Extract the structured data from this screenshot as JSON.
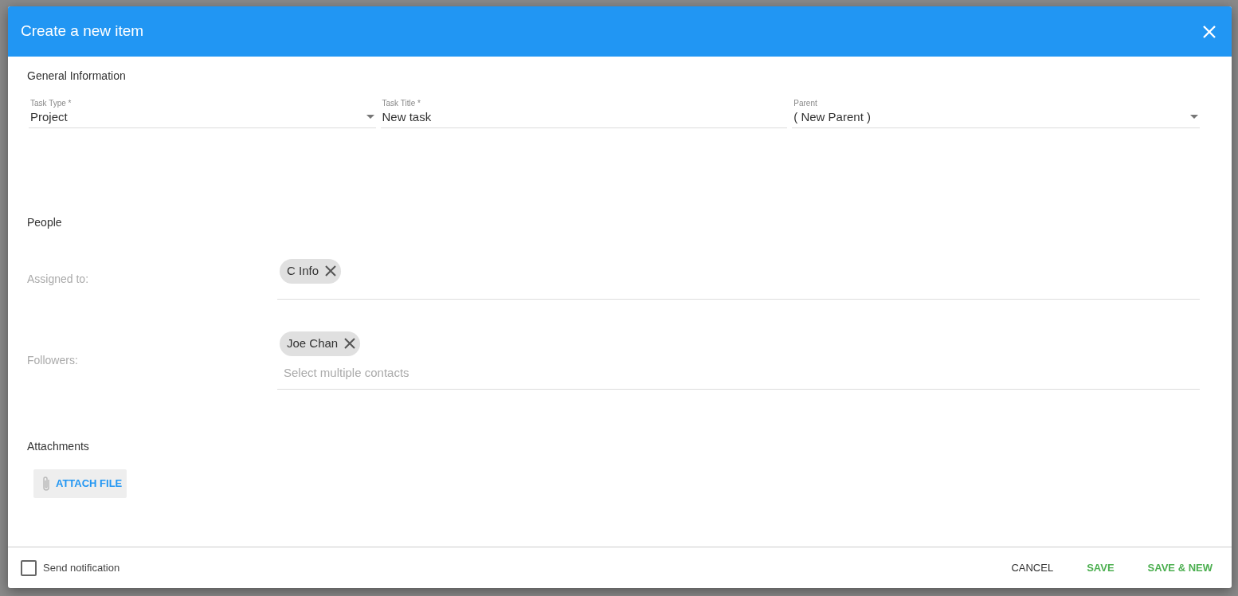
{
  "dialog": {
    "title": "Create a new item"
  },
  "general": {
    "heading": "General Information",
    "fields": [
      {
        "kind": "select",
        "label": "Task Type *",
        "value": "Project"
      },
      {
        "kind": "text",
        "label": "Task Title *",
        "value": "New task"
      },
      {
        "kind": "select",
        "label": "Parent",
        "value": "( New Parent )"
      }
    ]
  },
  "people": {
    "heading": "People",
    "rows": [
      {
        "label": "Assigned to:",
        "chips": [
          "C Info"
        ]
      },
      {
        "label": "Followers:",
        "chips": [
          "Joe Chan"
        ],
        "placeholder": "Select multiple contacts"
      }
    ]
  },
  "attachments": {
    "heading": "Attachments",
    "button": "ATTACH FILE"
  },
  "footer": {
    "checkbox": {
      "label": "Send notification",
      "checked": false
    },
    "buttons": [
      {
        "kind": "plain",
        "label": "CANCEL"
      },
      {
        "kind": "accent",
        "label": "SAVE"
      },
      {
        "kind": "accent",
        "label": "SAVE & NEW"
      }
    ]
  }
}
